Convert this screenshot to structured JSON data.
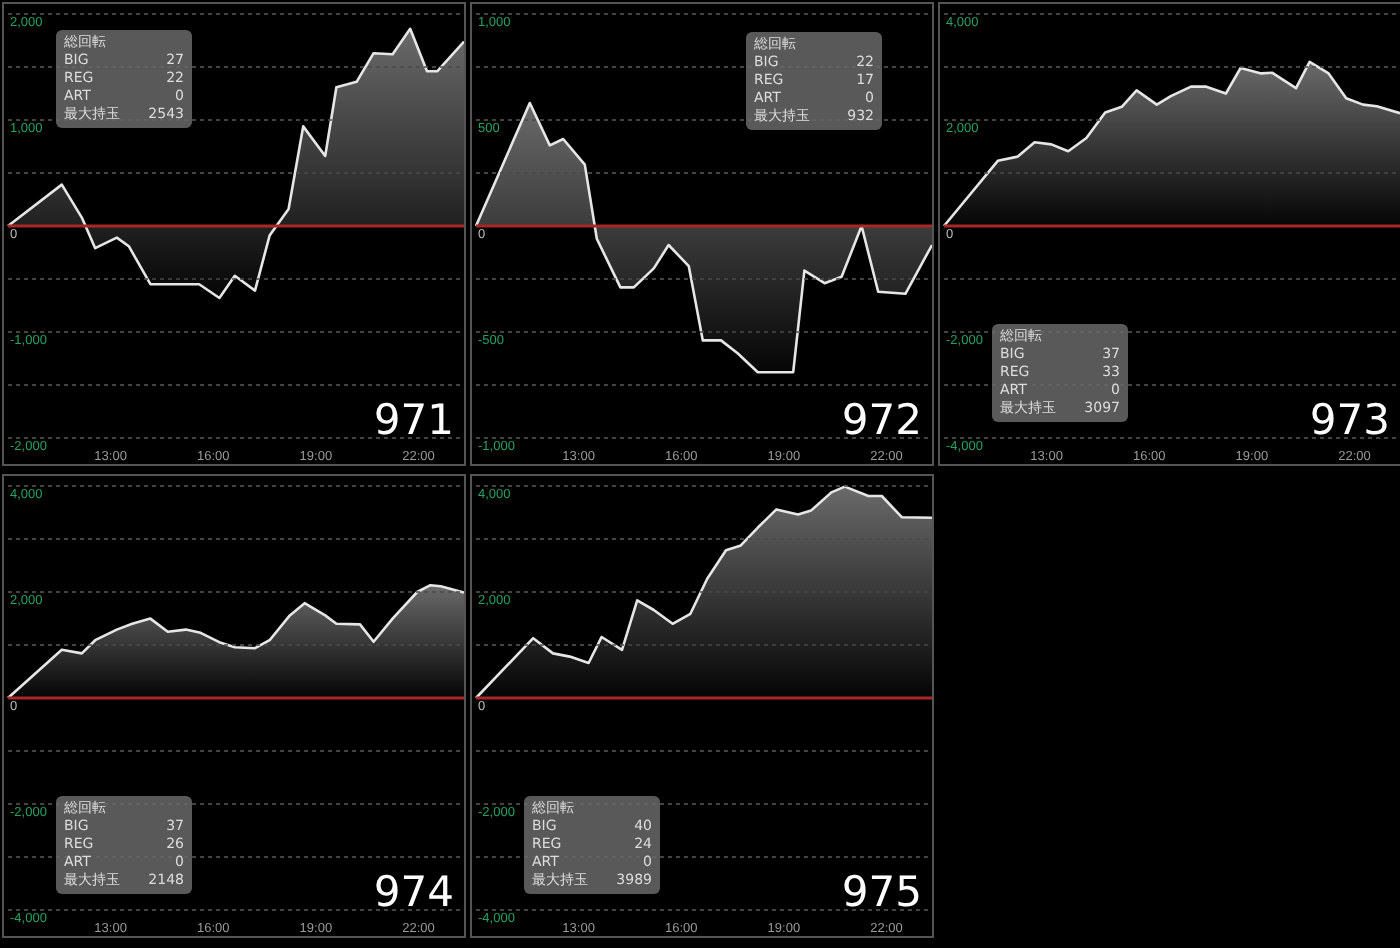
{
  "panels": [
    {
      "number": "971",
      "stats": {
        "title": "総回転",
        "rows": [
          {
            "label": "BIG",
            "value": "27"
          },
          {
            "label": "REG",
            "value": "22"
          },
          {
            "label": "ART",
            "value": "0"
          },
          {
            "label": "最大持玉",
            "value": "2543"
          }
        ]
      },
      "chart_data": {
        "type": "area",
        "grid": true,
        "ref_lines": [
          {
            "axis": "y",
            "value": 0,
            "color": "#a82828"
          }
        ],
        "xlim": [
          10,
          23.33
        ],
        "ylim": [
          -2000,
          2000
        ],
        "xticks": [
          {
            "value": 13,
            "label": "13:00"
          },
          {
            "value": 16,
            "label": "16:00"
          },
          {
            "value": 19,
            "label": "19:00"
          },
          {
            "value": 22,
            "label": "22:00"
          }
        ],
        "yticks": [
          {
            "value": -2000,
            "label": "-2,000"
          },
          {
            "value": -1000,
            "label": "-1,000"
          },
          {
            "value": 0,
            "label": "0"
          },
          {
            "value": 1000,
            "label": "1,000"
          },
          {
            "value": 2000,
            "label": "2,000"
          }
        ],
        "x": [
          10,
          11.57,
          12.16,
          12.55,
          13.18,
          13.53,
          14.16,
          15.59,
          16.18,
          16.63,
          17.22,
          17.65,
          18.2,
          18.63,
          19.27,
          19.6,
          20.19,
          20.69,
          21.24,
          21.76,
          22.25,
          22.55,
          23.33
        ],
        "series": [
          {
            "color": "#e6e6e6",
            "values": [
              0,
              390,
              80,
              -210,
              -110,
              -190,
              -550,
              -550,
              -680,
              -470,
              -610,
              -90,
              160,
              940,
              660,
              1310,
              1360,
              1630,
              1620,
              1860,
              1460,
              1460,
              1740
            ]
          }
        ]
      }
    },
    {
      "number": "972",
      "stats": {
        "title": "総回転",
        "rows": [
          {
            "label": "BIG",
            "value": "22"
          },
          {
            "label": "REG",
            "value": "17"
          },
          {
            "label": "ART",
            "value": "0"
          },
          {
            "label": "最大持玉",
            "value": "932"
          }
        ]
      },
      "chart_data": {
        "type": "area",
        "grid": true,
        "ref_lines": [
          {
            "axis": "y",
            "value": 0,
            "color": "#a82828"
          }
        ],
        "xlim": [
          10,
          23.33
        ],
        "ylim": [
          -1000,
          1000
        ],
        "xticks": [
          {
            "value": 13,
            "label": "13:00"
          },
          {
            "value": 16,
            "label": "16:00"
          },
          {
            "value": 19,
            "label": "19:00"
          },
          {
            "value": 22,
            "label": "22:00"
          }
        ],
        "yticks": [
          {
            "value": -1000,
            "label": "-1,000"
          },
          {
            "value": -500,
            "label": "-500"
          },
          {
            "value": 0,
            "label": "0"
          },
          {
            "value": 500,
            "label": "500"
          },
          {
            "value": 1000,
            "label": "1,000"
          }
        ],
        "x": [
          10,
          11.57,
          12.16,
          12.55,
          13.18,
          13.53,
          14.22,
          14.61,
          15.2,
          15.63,
          16.22,
          16.63,
          17.16,
          17.65,
          18.24,
          19.27,
          19.6,
          20.19,
          20.69,
          21.27,
          21.76,
          22.55,
          23.33
        ],
        "series": [
          {
            "color": "#e6e6e6",
            "values": [
              0,
              580,
              380,
              410,
              290,
              -60,
              -290,
              -290,
              -200,
              -90,
              -190,
              -540,
              -540,
              -600,
              -690,
              -690,
              -210,
              -270,
              -240,
              0,
              -310,
              -320,
              -90
            ]
          }
        ]
      }
    },
    {
      "number": "973",
      "stats": {
        "title": "総回転",
        "rows": [
          {
            "label": "BIG",
            "value": "37"
          },
          {
            "label": "REG",
            "value": "33"
          },
          {
            "label": "ART",
            "value": "0"
          },
          {
            "label": "最大持玉",
            "value": "3097"
          }
        ]
      },
      "chart_data": {
        "type": "area",
        "xlim": [
          10,
          23.33
        ],
        "ylim": [
          -4000,
          4000
        ],
        "xticks": [
          {
            "value": 13,
            "label": "13:00"
          },
          {
            "value": 16,
            "label": "16:00"
          },
          {
            "value": 19,
            "label": "19:00"
          },
          {
            "value": 22,
            "label": "22:00"
          }
        ],
        "yticks": [
          {
            "value": -4000,
            "label": "-4,000"
          },
          {
            "value": -2000,
            "label": "-2,000"
          },
          {
            "value": 0,
            "label": "0"
          },
          {
            "value": 2000,
            "label": "2,000"
          },
          {
            "value": 4000,
            "label": "4,000"
          }
        ],
        "grid": true,
        "ref_lines": [
          {
            "axis": "y",
            "value": 0,
            "color": "#a82828"
          }
        ],
        "x": [
          10,
          11.57,
          12.16,
          12.65,
          13.14,
          13.63,
          14.16,
          14.71,
          15.2,
          15.63,
          16.22,
          16.63,
          17.22,
          17.65,
          18.24,
          18.67,
          19.27,
          19.6,
          20.29,
          20.69,
          21.24,
          21.76,
          22.25,
          22.65,
          23.33
        ],
        "series": [
          {
            "color": "#e6e6e6",
            "values": [
              0,
              1230,
              1310,
              1580,
              1540,
              1410,
              1660,
              2140,
              2250,
              2560,
              2290,
              2450,
              2630,
              2630,
              2500,
              2980,
              2880,
              2890,
              2600,
              3100,
              2880,
              2410,
              2290,
              2260,
              2130
            ]
          }
        ]
      }
    },
    {
      "number": "974",
      "stats": {
        "title": "総回転",
        "rows": [
          {
            "label": "BIG",
            "value": "37"
          },
          {
            "label": "REG",
            "value": "26"
          },
          {
            "label": "ART",
            "value": "0"
          },
          {
            "label": "最大持玉",
            "value": "2148"
          }
        ]
      },
      "chart_data": {
        "type": "area",
        "xlim": [
          10,
          23.33
        ],
        "ylim": [
          -4000,
          4000
        ],
        "xticks": [
          {
            "value": 13,
            "label": "13:00"
          },
          {
            "value": 16,
            "label": "16:00"
          },
          {
            "value": 19,
            "label": "19:00"
          },
          {
            "value": 22,
            "label": "22:00"
          }
        ],
        "yticks": [
          {
            "value": -4000,
            "label": "-4,000"
          },
          {
            "value": -2000,
            "label": "-2,000"
          },
          {
            "value": 0,
            "label": "0"
          },
          {
            "value": 2000,
            "label": "2,000"
          },
          {
            "value": 4000,
            "label": "4,000"
          }
        ],
        "grid": true,
        "ref_lines": [
          {
            "axis": "y",
            "value": 0,
            "color": "#a82828"
          }
        ],
        "x": [
          10,
          11.57,
          12.16,
          12.55,
          13.18,
          13.63,
          14.16,
          14.67,
          15.2,
          15.63,
          16.22,
          16.63,
          17.22,
          17.65,
          18.24,
          18.67,
          19.27,
          19.6,
          20.29,
          20.69,
          21.24,
          21.96,
          22.35,
          22.65,
          23.33
        ],
        "series": [
          {
            "color": "#e6e6e6",
            "values": [
              0,
              910,
              840,
              1090,
              1290,
              1400,
              1500,
              1250,
              1290,
              1230,
              1040,
              960,
              940,
              1090,
              1560,
              1790,
              1560,
              1400,
              1390,
              1060,
              1500,
              2000,
              2130,
              2110,
              1990
            ]
          }
        ]
      }
    },
    {
      "number": "975",
      "stats": {
        "title": "総回転",
        "rows": [
          {
            "label": "BIG",
            "value": "40"
          },
          {
            "label": "REG",
            "value": "24"
          },
          {
            "label": "ART",
            "value": "0"
          },
          {
            "label": "最大持玉",
            "value": "3989"
          }
        ]
      },
      "chart_data": {
        "type": "area",
        "xlim": [
          10,
          23.33
        ],
        "ylim": [
          -4000,
          4000
        ],
        "xticks": [
          {
            "value": 13,
            "label": "13:00"
          },
          {
            "value": 16,
            "label": "16:00"
          },
          {
            "value": 19,
            "label": "19:00"
          },
          {
            "value": 22,
            "label": "22:00"
          }
        ],
        "yticks": [
          {
            "value": -4000,
            "label": "-4,000"
          },
          {
            "value": -2000,
            "label": "-2,000"
          },
          {
            "value": 0,
            "label": "0"
          },
          {
            "value": 2000,
            "label": "2,000"
          },
          {
            "value": 4000,
            "label": "4,000"
          }
        ],
        "grid": true,
        "ref_lines": [
          {
            "axis": "y",
            "value": 0,
            "color": "#a82828"
          }
        ],
        "x": [
          10,
          11.67,
          12.25,
          12.74,
          13.29,
          13.67,
          14.27,
          14.71,
          15.2,
          15.75,
          16.27,
          16.76,
          17.31,
          17.74,
          18.23,
          18.78,
          19.41,
          19.8,
          20.39,
          20.78,
          21.47,
          21.86,
          22.45,
          23.33
        ],
        "series": [
          {
            "color": "#e6e6e6",
            "values": [
              0,
              1130,
              840,
              780,
              660,
              1150,
              910,
              1840,
              1660,
              1400,
              1590,
              2250,
              2790,
              2880,
              3210,
              3560,
              3460,
              3540,
              3880,
              3990,
              3810,
              3810,
              3410,
              3400
            ]
          }
        ]
      }
    }
  ]
}
